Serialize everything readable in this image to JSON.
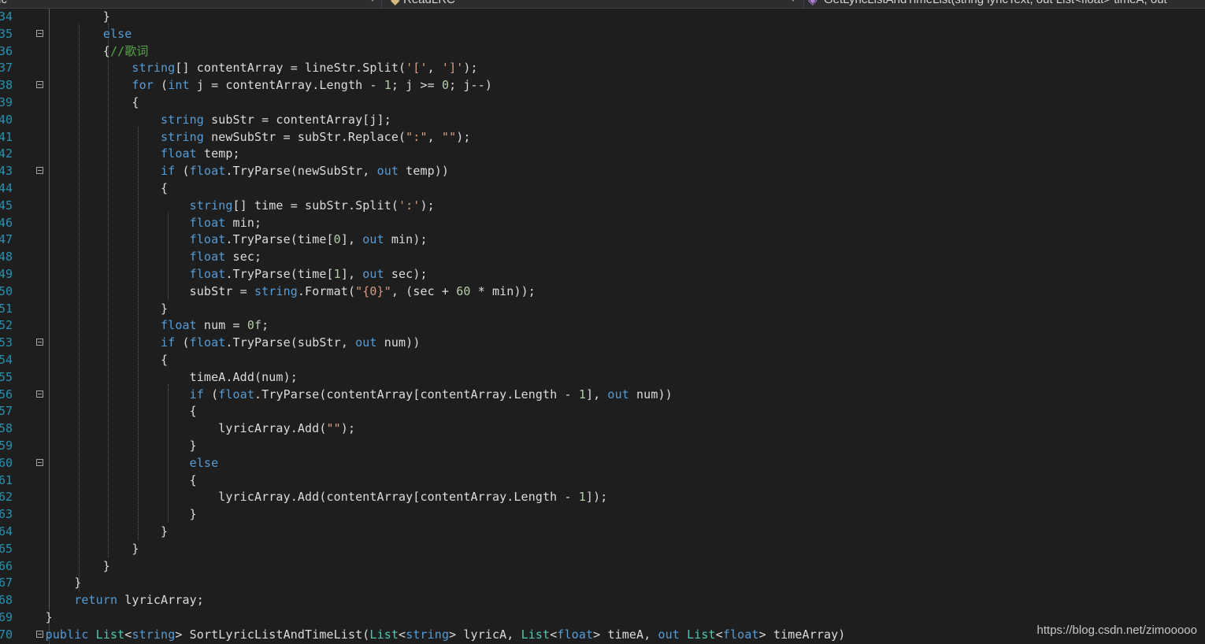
{
  "navbar": {
    "project_dropdown": "Public",
    "class_dropdown": "ReadLRC",
    "member_dropdown": "GetLyricListAndTimeList(string lyricText, out List<float> timeA, out"
  },
  "editor": {
    "language": "C#",
    "lines": [
      {
        "num": "34",
        "fold": false,
        "code": "            }"
      },
      {
        "num": "35",
        "fold": true,
        "code": "            else"
      },
      {
        "num": "36",
        "fold": false,
        "code": "            {//歌词"
      },
      {
        "num": "37",
        "fold": false,
        "code": "                string[] contentArray = lineStr.Split('[', ']');"
      },
      {
        "num": "38",
        "fold": true,
        "code": "                for (int j = contentArray.Length - 1; j >= 0; j--)"
      },
      {
        "num": "39",
        "fold": false,
        "code": "                {"
      },
      {
        "num": "40",
        "fold": false,
        "code": "                    string subStr = contentArray[j];"
      },
      {
        "num": "41",
        "fold": false,
        "code": "                    string newSubStr = subStr.Replace(\":\", \"\");"
      },
      {
        "num": "42",
        "fold": false,
        "code": "                    float temp;"
      },
      {
        "num": "43",
        "fold": true,
        "code": "                    if (float.TryParse(newSubStr, out temp))"
      },
      {
        "num": "44",
        "fold": false,
        "code": "                    {"
      },
      {
        "num": "45",
        "fold": false,
        "code": "                        string[] time = subStr.Split(':');"
      },
      {
        "num": "46",
        "fold": false,
        "code": "                        float min;"
      },
      {
        "num": "47",
        "fold": false,
        "code": "                        float.TryParse(time[0], out min);"
      },
      {
        "num": "48",
        "fold": false,
        "code": "                        float sec;"
      },
      {
        "num": "49",
        "fold": false,
        "code": "                        float.TryParse(time[1], out sec);"
      },
      {
        "num": "50",
        "fold": false,
        "code": "                        subStr = string.Format(\"{0}\", (sec + 60 * min));"
      },
      {
        "num": "51",
        "fold": false,
        "code": "                    }"
      },
      {
        "num": "52",
        "fold": false,
        "code": "                    float num = 0f;"
      },
      {
        "num": "53",
        "fold": true,
        "code": "                    if (float.TryParse(subStr, out num))"
      },
      {
        "num": "54",
        "fold": false,
        "code": "                    {"
      },
      {
        "num": "55",
        "fold": false,
        "code": "                        timeA.Add(num);"
      },
      {
        "num": "56",
        "fold": true,
        "code": "                        if (float.TryParse(contentArray[contentArray.Length - 1], out num))"
      },
      {
        "num": "57",
        "fold": false,
        "code": "                        {"
      },
      {
        "num": "58",
        "fold": false,
        "code": "                            lyricArray.Add(\"\");"
      },
      {
        "num": "59",
        "fold": false,
        "code": "                        }"
      },
      {
        "num": "60",
        "fold": true,
        "code": "                        else"
      },
      {
        "num": "61",
        "fold": false,
        "code": "                        {"
      },
      {
        "num": "62",
        "fold": false,
        "code": "                            lyricArray.Add(contentArray[contentArray.Length - 1]);"
      },
      {
        "num": "63",
        "fold": false,
        "code": "                        }"
      },
      {
        "num": "64",
        "fold": false,
        "code": "                    }"
      },
      {
        "num": "65",
        "fold": false,
        "code": "                }"
      },
      {
        "num": "66",
        "fold": false,
        "code": "            }"
      },
      {
        "num": "67",
        "fold": false,
        "code": "        }"
      },
      {
        "num": "68",
        "fold": false,
        "code": "        return lyricArray;"
      },
      {
        "num": "69",
        "fold": false,
        "code": "    }"
      },
      {
        "num": "70",
        "fold": true,
        "code": "    public List<string> SortLyricListAndTimeList(List<string> lyricA, List<float> timeA, out List<float> timeArray)"
      }
    ]
  },
  "colors": {
    "background": "#1e1e1e",
    "keyword": "#569cd6",
    "type": "#4ec9b0",
    "string": "#d69d85",
    "number": "#b5cea8",
    "comment": "#57a64a",
    "line_number": "#2b91af"
  },
  "watermark": "https://blog.csdn.net/zimooooo"
}
